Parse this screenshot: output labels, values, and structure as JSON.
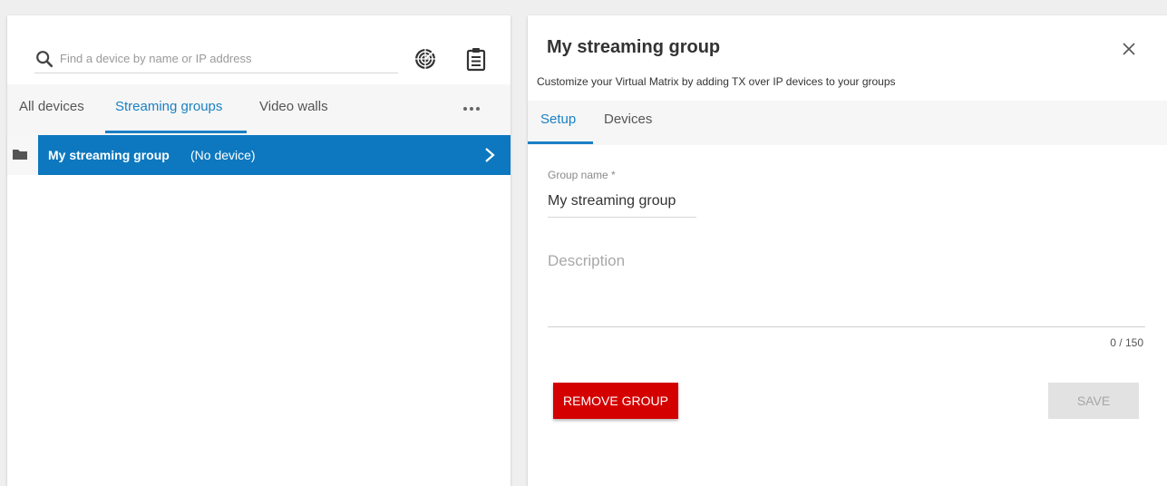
{
  "colors": {
    "accent": "#1b80c4",
    "selected_row": "#0d78bf",
    "danger": "#d40000",
    "disabled_button": "#e2e2e2"
  },
  "left": {
    "search": {
      "placeholder": "Find a device by name or IP address",
      "value": ""
    },
    "toolbar_icons": [
      "radar-icon",
      "clipboard-icon"
    ],
    "tabs": [
      {
        "label": "All devices",
        "active": false
      },
      {
        "label": "Streaming groups",
        "active": true
      },
      {
        "label": "Video walls",
        "active": false
      }
    ],
    "groups": [
      {
        "name": "My streaming group",
        "status": "(No device)",
        "icon": "folder-icon",
        "selected": true
      }
    ]
  },
  "right": {
    "title": "My streaming group",
    "subtitle": "Customize your Virtual Matrix by adding TX over IP devices to your groups",
    "tabs": [
      {
        "label": "Setup",
        "active": true
      },
      {
        "label": "Devices",
        "active": false
      }
    ],
    "form": {
      "group_name_label": "Group name *",
      "group_name_value": "My streaming group",
      "description_placeholder": "Description",
      "description_value": "",
      "counter": "0 / 150"
    },
    "remove_label": "REMOVE GROUP",
    "save_label": "SAVE"
  }
}
